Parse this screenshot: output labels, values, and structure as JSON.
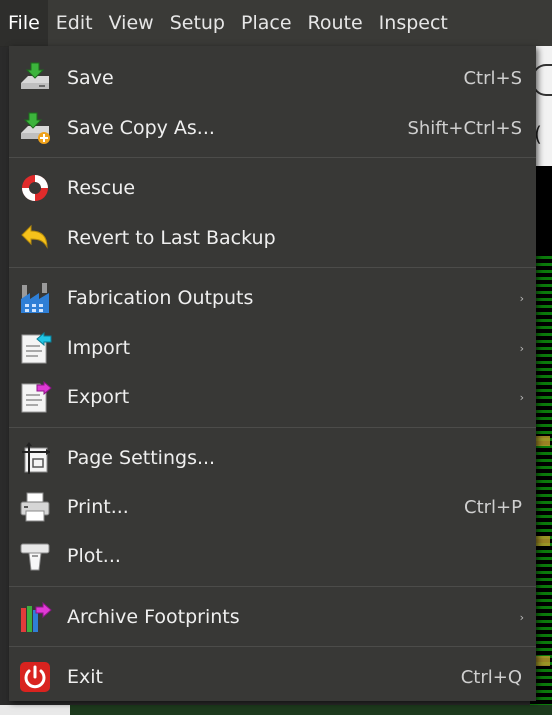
{
  "menubar": {
    "items": [
      "File",
      "Edit",
      "View",
      "Setup",
      "Place",
      "Route",
      "Inspect"
    ]
  },
  "file_menu": {
    "save": {
      "label": "Save",
      "shortcut": "Ctrl+S"
    },
    "save_copy_as": {
      "label": "Save Copy As...",
      "shortcut": "Shift+Ctrl+S"
    },
    "rescue": {
      "label": "Rescue"
    },
    "revert": {
      "label": "Revert to Last Backup"
    },
    "fabrication_outputs": {
      "label": "Fabrication Outputs",
      "submenu": true
    },
    "import": {
      "label": "Import",
      "submenu": true
    },
    "export": {
      "label": "Export",
      "submenu": true
    },
    "page_settings": {
      "label": "Page Settings..."
    },
    "print": {
      "label": "Print...",
      "shortcut": "Ctrl+P"
    },
    "plot": {
      "label": "Plot..."
    },
    "archive_footprints": {
      "label": "Archive Footprints",
      "submenu": true
    },
    "exit": {
      "label": "Exit",
      "shortcut": "Ctrl+Q"
    }
  },
  "submenu_arrow": "›",
  "colors": {
    "menu_bg": "#383836",
    "menubar_bg": "#3a3a37",
    "text": "#efefef",
    "pcb_green": "#0b7a0b"
  },
  "icons": {
    "save": "save-disk-icon",
    "save_copy_as": "save-copy-icon",
    "rescue": "lifebuoy-icon",
    "revert": "undo-arrow-icon",
    "fabrication_outputs": "factory-icon",
    "import": "import-document-icon",
    "export": "export-document-icon",
    "page_settings": "page-settings-icon",
    "print": "printer-icon",
    "plot": "plotter-icon",
    "archive_footprints": "archive-books-icon",
    "exit": "power-icon"
  }
}
